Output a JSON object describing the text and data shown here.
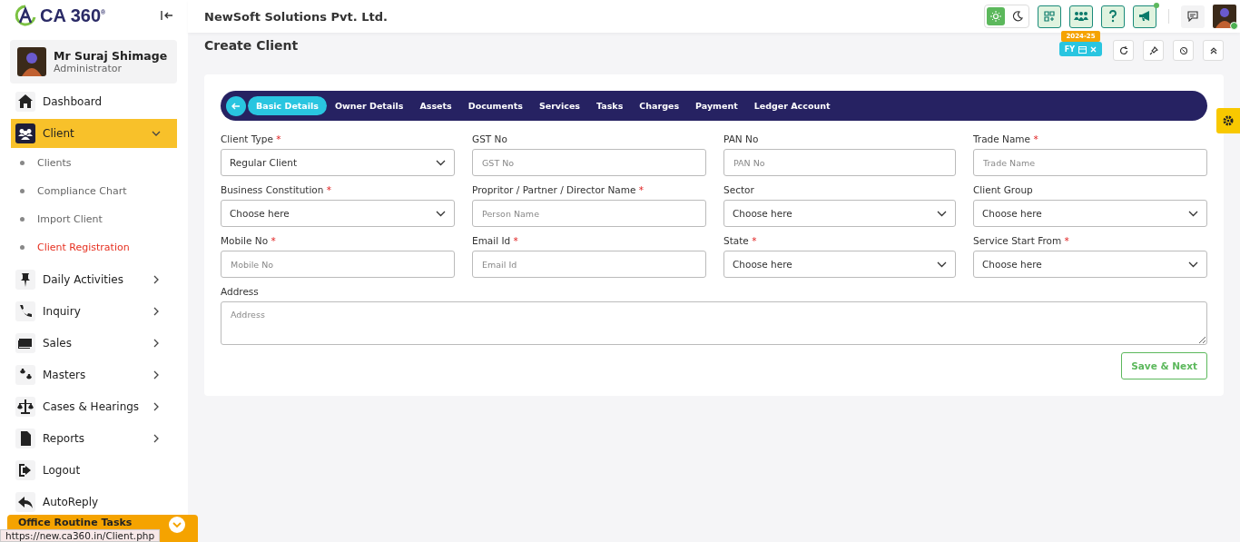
{
  "brand": {
    "name": "CA 360",
    "mark": "®"
  },
  "company": "NewSoft Solutions Pvt. Ltd.",
  "user": {
    "name": "Mr Suraj Shimage",
    "role": "Administrator"
  },
  "sidebar": {
    "items": [
      {
        "label": "Dashboard",
        "selected": false,
        "has_submenu": false
      },
      {
        "label": "Client",
        "selected": true,
        "expanded": true,
        "has_submenu": true,
        "children": [
          {
            "label": "Clients",
            "selected": false
          },
          {
            "label": "Compliance Chart",
            "selected": false
          },
          {
            "label": "Import Client",
            "selected": false
          },
          {
            "label": "Client Registration",
            "selected": true
          }
        ]
      },
      {
        "label": "Daily Activities",
        "selected": false,
        "expanded": false,
        "has_submenu": true
      },
      {
        "label": "Inquiry",
        "selected": false,
        "expanded": false,
        "has_submenu": true
      },
      {
        "label": "Sales",
        "selected": false,
        "expanded": false,
        "has_submenu": true
      },
      {
        "label": "Masters",
        "selected": false,
        "expanded": false,
        "has_submenu": true
      },
      {
        "label": "Cases & Hearings",
        "selected": false,
        "expanded": false,
        "has_submenu": true
      },
      {
        "label": "Reports",
        "selected": false,
        "expanded": false,
        "has_submenu": true
      },
      {
        "label": "Logout",
        "selected": false,
        "has_submenu": false
      },
      {
        "label": "AutoReply",
        "selected": false,
        "has_submenu": false
      }
    ]
  },
  "bottom_panel": {
    "label": "Office Routine Tasks"
  },
  "status_url": "https://new.ca360.in/Client.php",
  "dark_mode": false,
  "fy_badge": {
    "year": "2024-25",
    "label": "FY"
  },
  "page_title": "Create Client",
  "tabs": [
    {
      "label": "Basic Details",
      "selected": true
    },
    {
      "label": "Owner Details",
      "selected": false
    },
    {
      "label": "Assets",
      "selected": false
    },
    {
      "label": "Documents",
      "selected": false
    },
    {
      "label": "Services",
      "selected": false
    },
    {
      "label": "Tasks",
      "selected": false
    },
    {
      "label": "Charges",
      "selected": false
    },
    {
      "label": "Payment",
      "selected": false
    },
    {
      "label": "Ledger Account",
      "selected": false
    }
  ],
  "fields": [
    {
      "kind": "select",
      "label": "Client Type",
      "required_mark": "*",
      "value": "Regular Client"
    },
    {
      "kind": "input",
      "label": "GST No",
      "placeholder": "GST No"
    },
    {
      "kind": "input",
      "label": "PAN No",
      "placeholder": "PAN No"
    },
    {
      "kind": "input",
      "label": "Trade Name",
      "required_mark": "*",
      "placeholder": "Trade Name"
    },
    {
      "kind": "select",
      "label": "Business Constitution",
      "required_mark": "*",
      "value": "Choose here"
    },
    {
      "kind": "input",
      "label": "Propritor / Partner / Director Name",
      "required_mark": "*",
      "placeholder": "Person Name"
    },
    {
      "kind": "select",
      "label": "Sector",
      "value": "Choose here"
    },
    {
      "kind": "select",
      "label": "Client Group",
      "value": "Choose here"
    },
    {
      "kind": "input",
      "label": "Mobile No",
      "required_mark": "*",
      "placeholder": "Mobile No"
    },
    {
      "kind": "input",
      "label": "Email Id",
      "required_mark": "*",
      "placeholder": "Email Id"
    },
    {
      "kind": "select",
      "label": "State",
      "required_mark": "*",
      "value": "Choose here"
    },
    {
      "kind": "select",
      "label": "Service Start From",
      "required_mark": "*",
      "value": "Choose here"
    },
    {
      "kind": "textarea",
      "label": "Address",
      "placeholder": "Address"
    }
  ],
  "save_button": "Save & Next"
}
